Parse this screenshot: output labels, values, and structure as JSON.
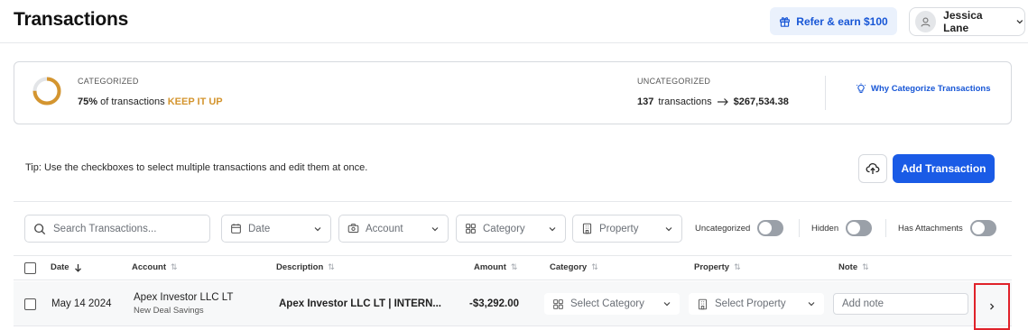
{
  "header": {
    "title": "Transactions",
    "refer_label": "Refer & earn $100",
    "user_name": "Jessica Lane"
  },
  "summary": {
    "categorized_label": "CATEGORIZED",
    "categorized_percent": "75%",
    "categorized_fraction": 0.75,
    "categorized_text": "of transactions",
    "keep_label": "KEEP IT UP",
    "uncategorized_label": "UNCATEGORIZED",
    "uncategorized_count": "137",
    "uncategorized_text": "transactions",
    "uncategorized_amount": "$267,534.38",
    "why_link": "Why Categorize Transactions"
  },
  "tip": "Tip: Use the checkboxes to select multiple transactions and edit them at once.",
  "actions": {
    "add_label": "Add Transaction"
  },
  "filters": {
    "search_placeholder": "Search Transactions...",
    "date": "Date",
    "account": "Account",
    "category": "Category",
    "property": "Property",
    "uncategorized_toggle": "Uncategorized",
    "hidden_toggle": "Hidden",
    "attachments_toggle": "Has Attachments"
  },
  "table": {
    "columns": [
      "Date",
      "Account",
      "Description",
      "Amount",
      "Category",
      "Property",
      "Note"
    ],
    "rows": [
      {
        "date": "May 14 2024",
        "account": "Apex Investor LLC LT",
        "account_sub": "New Deal Savings",
        "description": "Apex Investor LLC LT | INTERN...",
        "amount": "-$3,292.00",
        "category_placeholder": "Select Category",
        "property_placeholder": "Select Property",
        "note_placeholder": "Add note"
      }
    ]
  },
  "colors": {
    "accent": "#1a5be6",
    "keep": "#d4952f",
    "donut_track": "#e3e5e8",
    "highlight": "#e0222a"
  },
  "icons": [
    "gift-icon",
    "user-icon",
    "chevron-down-icon",
    "lightbulb-icon",
    "cloud-upload-icon",
    "search-icon",
    "calendar-icon",
    "bank-icon",
    "grid-icon",
    "building-icon",
    "sort-icon",
    "chevron-right-icon"
  ]
}
